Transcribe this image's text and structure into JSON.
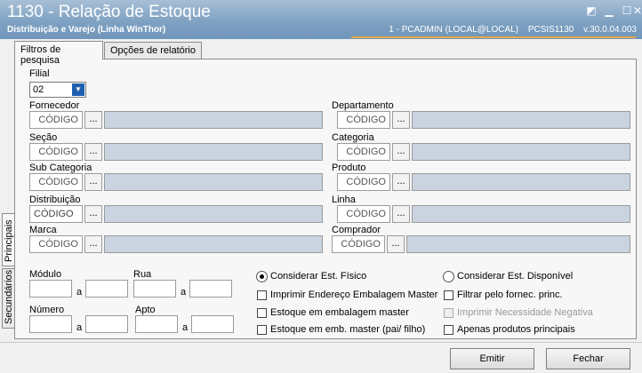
{
  "window": {
    "title": "1130 - Relação de Estoque",
    "subtitle": "Distribuição e Varejo (Linha WinThor)",
    "user": "1 - PCADMIN (LOCAL@LOCAL)",
    "routine": "PCSIS1130",
    "version": "v.30.0.04.003"
  },
  "tabs": [
    "Filtros de pesquisa",
    "Opções de relatório"
  ],
  "side_tabs": [
    "Principais",
    "Secundários"
  ],
  "filial": {
    "label": "Filial",
    "value": "02"
  },
  "code_placeholder": "CÓDIGO",
  "ellipsis": "...",
  "fields_left": [
    "Fornecedor",
    "Seção",
    "Sub Categoria",
    "Distribuição",
    "Marca"
  ],
  "fields_right": [
    "Departamento",
    "Categoria",
    "Produto",
    "Linha",
    "Comprador"
  ],
  "ranges": {
    "modulo": "Módulo",
    "rua": "Rua",
    "numero": "Número",
    "apto": "Apto",
    "a": "a"
  },
  "options": {
    "radio_fisico": "Considerar Est. Físico",
    "radio_disponivel": "Considerar Est. Disponível",
    "chk_endereco": "Imprimir Endereço Embalagem Master",
    "chk_fornec": "Filtrar pelo fornec. princ.",
    "chk_emb_master": "Estoque em embalagem master",
    "chk_necessidade": "Imprimir Necessidade Negativa",
    "chk_pai_filho": "Estoque em emb. master (pai/ filho)",
    "chk_principais": "Apenas produtos principais"
  },
  "buttons": {
    "emitir": "Emitir",
    "fechar": "Fechar"
  }
}
